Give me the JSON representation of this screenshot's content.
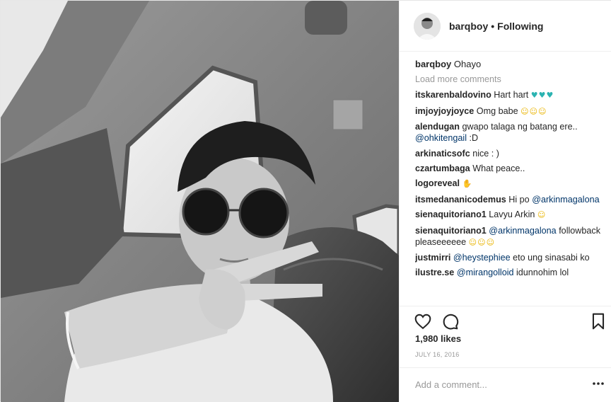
{
  "header": {
    "username": "barqboy",
    "separator": "•",
    "follow_status": "Following"
  },
  "caption": {
    "user": "barqboy",
    "text": "Ohayo"
  },
  "load_more": "Load more comments",
  "comments": [
    {
      "user": "itskarenbaldovino",
      "text": "Hart hart",
      "emoji": "♥♥♥",
      "emoji_color": "teal"
    },
    {
      "user": "imjoyjoyjoyce",
      "text": "Omg babe",
      "emoji": "☺☺☺",
      "emoji_color": "yel"
    },
    {
      "user": "alendugan",
      "text": "gwapo talaga ng batang ere..",
      "mention": "@ohkitengail",
      "after": ":D"
    },
    {
      "user": "arkinaticsofc",
      "text": "nice : )"
    },
    {
      "user": "czartumbaga",
      "text": "What peace.."
    },
    {
      "user": "logoreveal",
      "emoji": "✋",
      "emoji_color": "skin"
    },
    {
      "user": "itsmedananicodemus",
      "text": "Hi po",
      "mention": "@arkinmagalona"
    },
    {
      "user": "sienaquitoriano1",
      "text": "Lavyu Arkin",
      "emoji": "☺",
      "emoji_color": "yel"
    },
    {
      "user": "sienaquitoriano1",
      "mention": "@arkinmagalona",
      "after": "followback pleaseeeeee",
      "emoji": "☺☺☺",
      "emoji_color": "yel"
    },
    {
      "user": "justmirri",
      "mention": "@heystephiee",
      "after": "eto ung sinasabi ko"
    },
    {
      "user": "ilustre.se",
      "mention": "@mirangolloid",
      "after": "idunnohim lol"
    }
  ],
  "likes": "1,980 likes",
  "date": "JULY 16, 2016",
  "add_comment": {
    "placeholder": "Add a comment..."
  },
  "icons": {
    "like": "heart-icon",
    "comment": "comment-icon",
    "save": "bookmark-icon",
    "options": "more-options-icon"
  },
  "colors": {
    "link": "#003569",
    "muted": "#999999",
    "text": "#262626"
  }
}
